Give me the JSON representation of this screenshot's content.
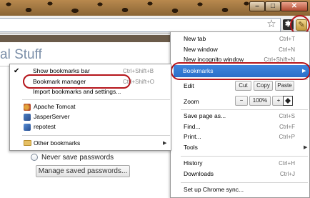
{
  "window": {
    "minimize": "–",
    "maximize": "□",
    "close": "✕"
  },
  "toolbar": {
    "star": "☆",
    "extension": "✱",
    "wrench": "✎"
  },
  "page": {
    "title": "al Stuff",
    "never_save": "Never save passwords",
    "manage_button": "Manage saved passwords..."
  },
  "main_menu": {
    "new_tab": "New tab",
    "new_tab_sc": "Ctrl+T",
    "new_window": "New window",
    "new_window_sc": "Ctrl+N",
    "incognito": "New incognito window",
    "incognito_sc": "Ctrl+Shift+N",
    "bookmarks": "Bookmarks",
    "edit": "Edit",
    "cut": "Cut",
    "copy": "Copy",
    "paste": "Paste",
    "zoom": "Zoom",
    "zoom_minus": "−",
    "zoom_value": "100%",
    "zoom_plus": "+",
    "save_page": "Save page as...",
    "save_page_sc": "Ctrl+S",
    "find": "Find...",
    "find_sc": "Ctrl+F",
    "print": "Print...",
    "print_sc": "Ctrl+P",
    "tools": "Tools",
    "history": "History",
    "history_sc": "Ctrl+H",
    "downloads": "Downloads",
    "downloads_sc": "Ctrl+J",
    "sync": "Set up Chrome sync..."
  },
  "bookmarks_menu": {
    "show_bar": "Show bookmarks bar",
    "show_bar_sc": "Ctrl+Shift+B",
    "manager": "Bookmark manager",
    "manager_sc": "Ctrl+Shift+O",
    "import": "Import bookmarks and settings...",
    "items": [
      "Apache Tomcat",
      "JasperServer",
      "repotest"
    ],
    "other": "Other bookmarks",
    "check": "✔"
  }
}
